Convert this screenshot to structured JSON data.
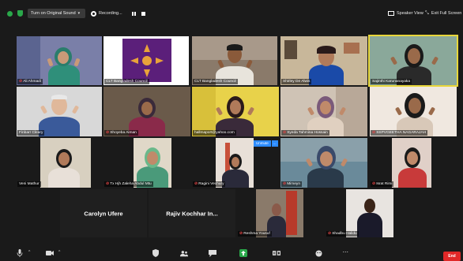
{
  "topbar": {
    "original_sound_label": "Turn on Original Sound",
    "recording_label": "Recording...",
    "speaker_view_label": "Speaker View",
    "exit_full_screen_label": "Exit Full Screen"
  },
  "participants": [
    {
      "name": "Ali Ahmadi",
      "muted": true
    },
    {
      "name": "CLT Bangladesh Council",
      "muted": false
    },
    {
      "name": "CLT Bangladesh Council",
      "muted": false
    },
    {
      "name": "Shirley De Alwis",
      "muted": false
    },
    {
      "name": "Sajinthi Karunanayaka",
      "muted": false
    },
    {
      "name": "Finbarr Cleary",
      "muted": false
    },
    {
      "name": "Shoyeba Aiman",
      "muted": true
    },
    {
      "name": "hallmaport@yahoo.com",
      "muted": false
    },
    {
      "name": "Syeda Tahmina Hossain",
      "muted": true
    },
    {
      "name": "SSPVGEETHA NAGARAJAH",
      "muted": true
    },
    {
      "name": "Veni Mathur",
      "muted": false
    },
    {
      "name": "Tx Hjh Zaleha Abdul Mtu",
      "muted": true
    },
    {
      "name": "Ragini Vechury",
      "muted": true
    },
    {
      "name": "Mimeyn",
      "muted": true
    },
    {
      "name": "Israt Rimi",
      "muted": true
    },
    {
      "name": "Carolyn Ufere",
      "muted": false
    },
    {
      "name": "Rajiv Kochhar In...",
      "muted": false
    },
    {
      "name": "Reshma Yousuf",
      "muted": true
    },
    {
      "name": "Shadbu Halidu",
      "muted": true
    }
  ],
  "unmute_popup": {
    "label": "Unmute",
    "more": "..."
  },
  "bottombar": {
    "end_label": "End"
  },
  "colors": {
    "muted_red": "#e04545",
    "shield_green": "#2aa84a",
    "unmute_blue": "#2d8cff",
    "end_red": "#e02828"
  }
}
